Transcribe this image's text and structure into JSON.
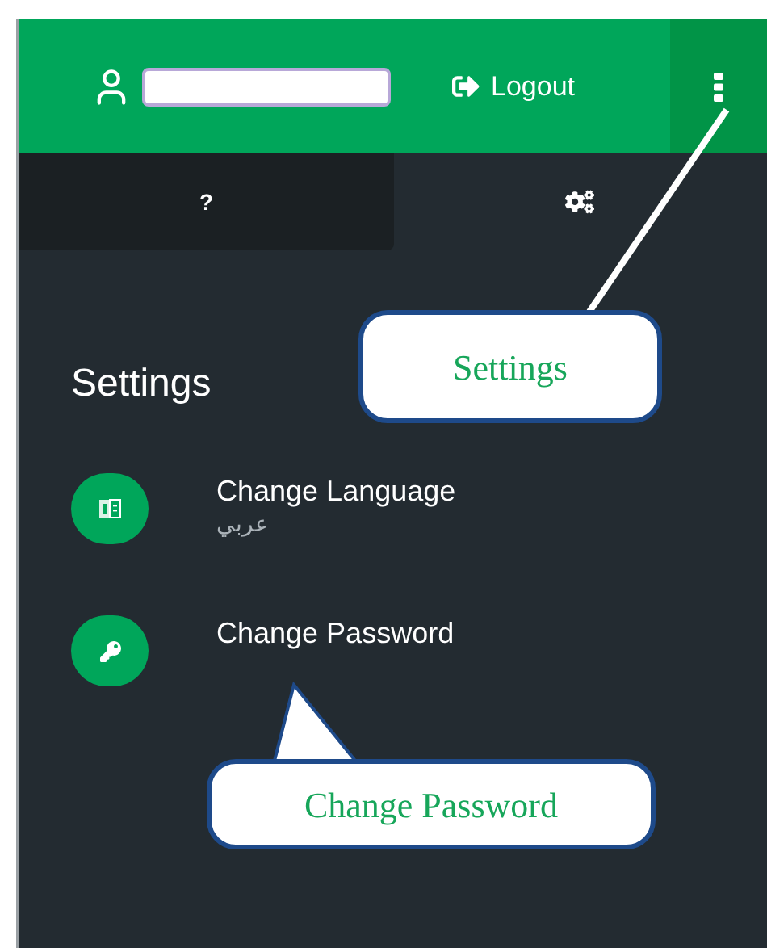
{
  "header": {
    "logout": "Logout"
  },
  "tabs": [
    {
      "label": "?",
      "selected": false
    },
    {
      "kind": "icon",
      "selected": true
    }
  ],
  "settings": {
    "title": "Settings",
    "items": [
      {
        "kind": "language",
        "title": "Change Language",
        "subtitle": "عربي"
      },
      {
        "kind": "password",
        "title": "Change Password"
      }
    ]
  },
  "callouts": [
    {
      "text": "Settings"
    },
    {
      "text": "Change Password"
    }
  ]
}
